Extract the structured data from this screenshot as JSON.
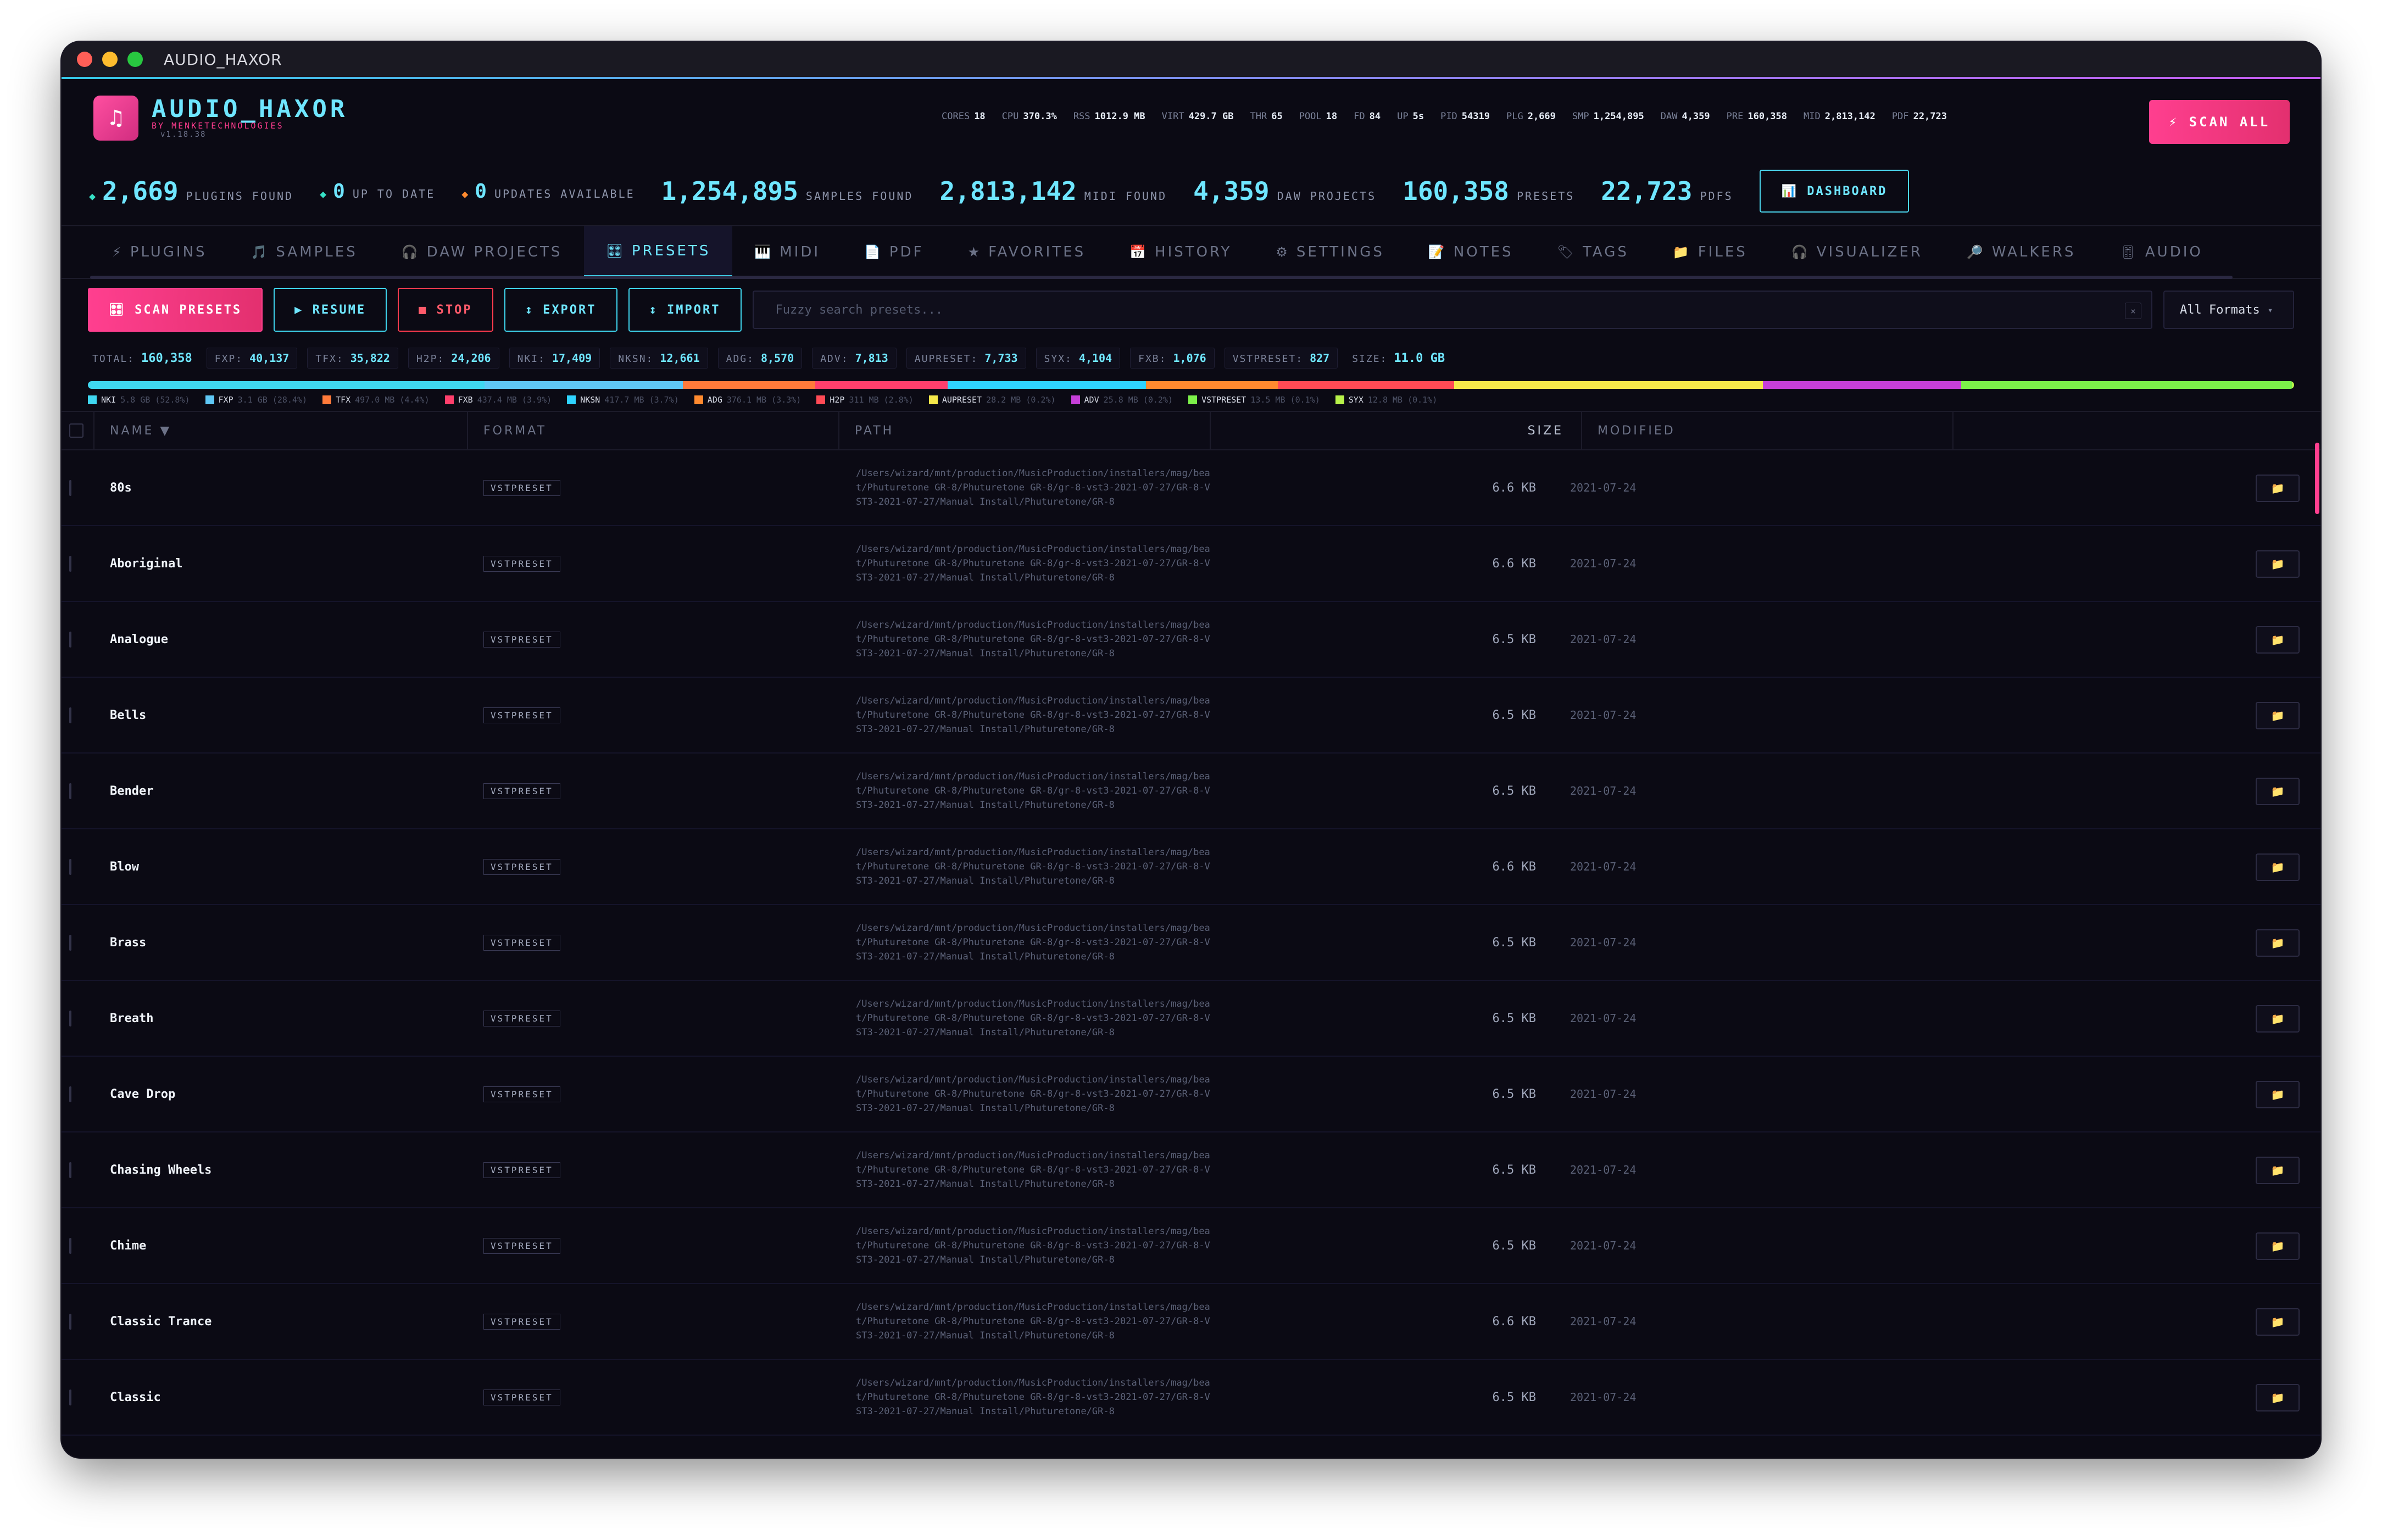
{
  "window": {
    "title": "AUDIO_HAXOR"
  },
  "brand": {
    "name": "AUDIO_HAXOR",
    "byline": "BY MENKETECHNOLOGIES",
    "version": "v1.18.38",
    "logo_icon": "♫"
  },
  "sysstats": [
    {
      "k": "CORES",
      "v": "18"
    },
    {
      "k": "CPU",
      "v": "370.3%"
    },
    {
      "k": "RSS",
      "v": "1012.9 MB"
    },
    {
      "k": "VIRT",
      "v": "429.7 GB"
    },
    {
      "k": "THR",
      "v": "65"
    },
    {
      "k": "POOL",
      "v": "18"
    },
    {
      "k": "FD",
      "v": "84"
    },
    {
      "k": "UP",
      "v": "5s"
    },
    {
      "k": "PID",
      "v": "54319"
    },
    {
      "k": "PLG",
      "v": "2,669"
    },
    {
      "k": "SMP",
      "v": "1,254,895"
    },
    {
      "k": "DAW",
      "v": "4,359"
    },
    {
      "k": "PRE",
      "v": "160,358"
    },
    {
      "k": "MID",
      "v": "2,813,142"
    },
    {
      "k": "PDF",
      "v": "22,723"
    }
  ],
  "scan_all_label": "⚡ SCAN ALL",
  "summary": {
    "plugins": {
      "num": "2,669",
      "label": "PLUGINS FOUND"
    },
    "uptodate": {
      "num": "0",
      "label": "UP TO DATE"
    },
    "updates": {
      "num": "0",
      "label": "UPDATES AVAILABLE"
    },
    "samples": {
      "num": "1,254,895",
      "label": "SAMPLES FOUND"
    },
    "midi": {
      "num": "2,813,142",
      "label": "MIDI FOUND"
    },
    "daw": {
      "num": "4,359",
      "label": "DAW PROJECTS"
    },
    "presets": {
      "num": "160,358",
      "label": "PRESETS"
    },
    "pdfs": {
      "num": "22,723",
      "label": "PDFS"
    },
    "dashboard": "📊 DASHBOARD"
  },
  "tabs": [
    {
      "icon": "⚡",
      "label": "PLUGINS"
    },
    {
      "icon": "🎵",
      "label": "SAMPLES"
    },
    {
      "icon": "🎧",
      "label": "DAW PROJECTS"
    },
    {
      "icon": "🎛",
      "label": "PRESETS",
      "active": true
    },
    {
      "icon": "🎹",
      "label": "MIDI"
    },
    {
      "icon": "📄",
      "label": "PDF"
    },
    {
      "icon": "★",
      "label": "FAVORITES"
    },
    {
      "icon": "📅",
      "label": "HISTORY"
    },
    {
      "icon": "⚙",
      "label": "SETTINGS"
    },
    {
      "icon": "📝",
      "label": "NOTES"
    },
    {
      "icon": "🏷",
      "label": "TAGS"
    },
    {
      "icon": "📁",
      "label": "FILES"
    },
    {
      "icon": "🎧",
      "label": "VISUALIZER"
    },
    {
      "icon": "🔎",
      "label": "WALKERS"
    },
    {
      "icon": "🎚",
      "label": "AUDIO"
    }
  ],
  "toolbar": {
    "scan": "🎛 SCAN PRESETS",
    "resume": "▶ RESUME",
    "stop": "■ STOP",
    "export": "↕ EXPORT",
    "import": "↕ IMPORT",
    "search_placeholder": "Fuzzy search presets...",
    "clear": "×",
    "format": "All Formats"
  },
  "counts": {
    "total": {
      "k": "TOTAL:",
      "v": "160,358"
    },
    "items": [
      {
        "k": "FXP:",
        "v": "40,137"
      },
      {
        "k": "TFX:",
        "v": "35,822"
      },
      {
        "k": "H2P:",
        "v": "24,206"
      },
      {
        "k": "NKI:",
        "v": "17,409"
      },
      {
        "k": "NKSN:",
        "v": "12,661"
      },
      {
        "k": "ADG:",
        "v": "8,570"
      },
      {
        "k": "ADV:",
        "v": "7,813"
      },
      {
        "k": "AUPRESET:",
        "v": "7,733"
      },
      {
        "k": "SYX:",
        "v": "4,104"
      },
      {
        "k": "FXB:",
        "v": "1,076"
      },
      {
        "k": "VSTPRESET:",
        "v": "827"
      }
    ],
    "size": {
      "k": "SIZE:",
      "v": "11.0 GB"
    }
  },
  "distribution": [
    {
      "name": "NKI",
      "detail": "5.8 GB (52.8%)",
      "color": "#3fd7f0",
      "fraction": 0.528
    },
    {
      "name": "FXP",
      "detail": "3.1 GB (28.4%)",
      "color": "#5fc7f5",
      "fraction": 0.284
    },
    {
      "name": "TFX",
      "detail": "497.0 MB (4.4%)",
      "color": "#ff7a3a",
      "fraction": 0.044
    },
    {
      "name": "FXB",
      "detail": "437.4 MB (3.9%)",
      "color": "#ff3f6c",
      "fraction": 0.039
    },
    {
      "name": "NKSN",
      "detail": "417.7 MB (3.7%)",
      "color": "#2fd3ff",
      "fraction": 0.037
    },
    {
      "name": "ADG",
      "detail": "376.1 MB (3.3%)",
      "color": "#ff8a2f",
      "fraction": 0.033
    },
    {
      "name": "H2P",
      "detail": "311 MB (2.8%)",
      "color": "#ff4a55",
      "fraction": 0.028
    },
    {
      "name": "AUPRESET",
      "detail": "28.2 MB (0.2%)",
      "color": "#f5e84a",
      "fraction": 0.002
    },
    {
      "name": "ADV",
      "detail": "25.8 MB (0.2%)",
      "color": "#c63fd8",
      "fraction": 0.002
    },
    {
      "name": "VSTPRESET",
      "detail": "13.5 MB (0.1%)",
      "color": "#7cf04a",
      "fraction": 0.001
    },
    {
      "name": "SYX",
      "detail": "12.8 MB (0.1%)",
      "color": "#b8f24a",
      "fraction": 0.001
    }
  ],
  "table": {
    "columns": [
      "NAME ▼",
      "FORMAT",
      "PATH",
      "SIZE",
      "MODIFIED"
    ],
    "rows": [
      {
        "name": "80s",
        "format": "VSTPRESET",
        "path": "/Users/wizard/mnt/production/MusicProduction/installers/mag/beat/Phuturetone GR-8/Phuturetone GR-8/gr-8-vst3-2021-07-27/GR-8-VST3-2021-07-27/Manual Install/Phuturetone/GR-8",
        "size": "6.6 KB",
        "modified": "2021-07-24"
      },
      {
        "name": "Aboriginal",
        "format": "VSTPRESET",
        "path": "/Users/wizard/mnt/production/MusicProduction/installers/mag/beat/Phuturetone GR-8/Phuturetone GR-8/gr-8-vst3-2021-07-27/GR-8-VST3-2021-07-27/Manual Install/Phuturetone/GR-8",
        "size": "6.6 KB",
        "modified": "2021-07-24"
      },
      {
        "name": "Analogue",
        "format": "VSTPRESET",
        "path": "/Users/wizard/mnt/production/MusicProduction/installers/mag/beat/Phuturetone GR-8/Phuturetone GR-8/gr-8-vst3-2021-07-27/GR-8-VST3-2021-07-27/Manual Install/Phuturetone/GR-8",
        "size": "6.5 KB",
        "modified": "2021-07-24"
      },
      {
        "name": "Bells",
        "format": "VSTPRESET",
        "path": "/Users/wizard/mnt/production/MusicProduction/installers/mag/beat/Phuturetone GR-8/Phuturetone GR-8/gr-8-vst3-2021-07-27/GR-8-VST3-2021-07-27/Manual Install/Phuturetone/GR-8",
        "size": "6.5 KB",
        "modified": "2021-07-24"
      },
      {
        "name": "Bender",
        "format": "VSTPRESET",
        "path": "/Users/wizard/mnt/production/MusicProduction/installers/mag/beat/Phuturetone GR-8/Phuturetone GR-8/gr-8-vst3-2021-07-27/GR-8-VST3-2021-07-27/Manual Install/Phuturetone/GR-8",
        "size": "6.5 KB",
        "modified": "2021-07-24"
      },
      {
        "name": "Blow",
        "format": "VSTPRESET",
        "path": "/Users/wizard/mnt/production/MusicProduction/installers/mag/beat/Phuturetone GR-8/Phuturetone GR-8/gr-8-vst3-2021-07-27/GR-8-VST3-2021-07-27/Manual Install/Phuturetone/GR-8",
        "size": "6.6 KB",
        "modified": "2021-07-24"
      },
      {
        "name": "Brass",
        "format": "VSTPRESET",
        "path": "/Users/wizard/mnt/production/MusicProduction/installers/mag/beat/Phuturetone GR-8/Phuturetone GR-8/gr-8-vst3-2021-07-27/GR-8-VST3-2021-07-27/Manual Install/Phuturetone/GR-8",
        "size": "6.5 KB",
        "modified": "2021-07-24"
      },
      {
        "name": "Breath",
        "format": "VSTPRESET",
        "path": "/Users/wizard/mnt/production/MusicProduction/installers/mag/beat/Phuturetone GR-8/Phuturetone GR-8/gr-8-vst3-2021-07-27/GR-8-VST3-2021-07-27/Manual Install/Phuturetone/GR-8",
        "size": "6.5 KB",
        "modified": "2021-07-24"
      },
      {
        "name": "Cave Drop",
        "format": "VSTPRESET",
        "path": "/Users/wizard/mnt/production/MusicProduction/installers/mag/beat/Phuturetone GR-8/Phuturetone GR-8/gr-8-vst3-2021-07-27/GR-8-VST3-2021-07-27/Manual Install/Phuturetone/GR-8",
        "size": "6.5 KB",
        "modified": "2021-07-24"
      },
      {
        "name": "Chasing Wheels",
        "format": "VSTPRESET",
        "path": "/Users/wizard/mnt/production/MusicProduction/installers/mag/beat/Phuturetone GR-8/Phuturetone GR-8/gr-8-vst3-2021-07-27/GR-8-VST3-2021-07-27/Manual Install/Phuturetone/GR-8",
        "size": "6.5 KB",
        "modified": "2021-07-24"
      },
      {
        "name": "Chime",
        "format": "VSTPRESET",
        "path": "/Users/wizard/mnt/production/MusicProduction/installers/mag/beat/Phuturetone GR-8/Phuturetone GR-8/gr-8-vst3-2021-07-27/GR-8-VST3-2021-07-27/Manual Install/Phuturetone/GR-8",
        "size": "6.5 KB",
        "modified": "2021-07-24"
      },
      {
        "name": "Classic Trance",
        "format": "VSTPRESET",
        "path": "/Users/wizard/mnt/production/MusicProduction/installers/mag/beat/Phuturetone GR-8/Phuturetone GR-8/gr-8-vst3-2021-07-27/GR-8-VST3-2021-07-27/Manual Install/Phuturetone/GR-8",
        "size": "6.6 KB",
        "modified": "2021-07-24"
      },
      {
        "name": "Classic",
        "format": "VSTPRESET",
        "path": "/Users/wizard/mnt/production/MusicProduction/installers/mag/beat/Phuturetone GR-8/Phuturetone GR-8/gr-8-vst3-2021-07-27/GR-8-VST3-2021-07-27/Manual Install/Phuturetone/GR-8",
        "size": "6.5 KB",
        "modified": "2021-07-24"
      }
    ],
    "row_action_icon": "📁"
  },
  "colors": {
    "accent": "#3fd7f0",
    "brand_pink": "#ff3f8f",
    "stop_red": "#ff3b4e",
    "bg": "#0b0a14"
  }
}
